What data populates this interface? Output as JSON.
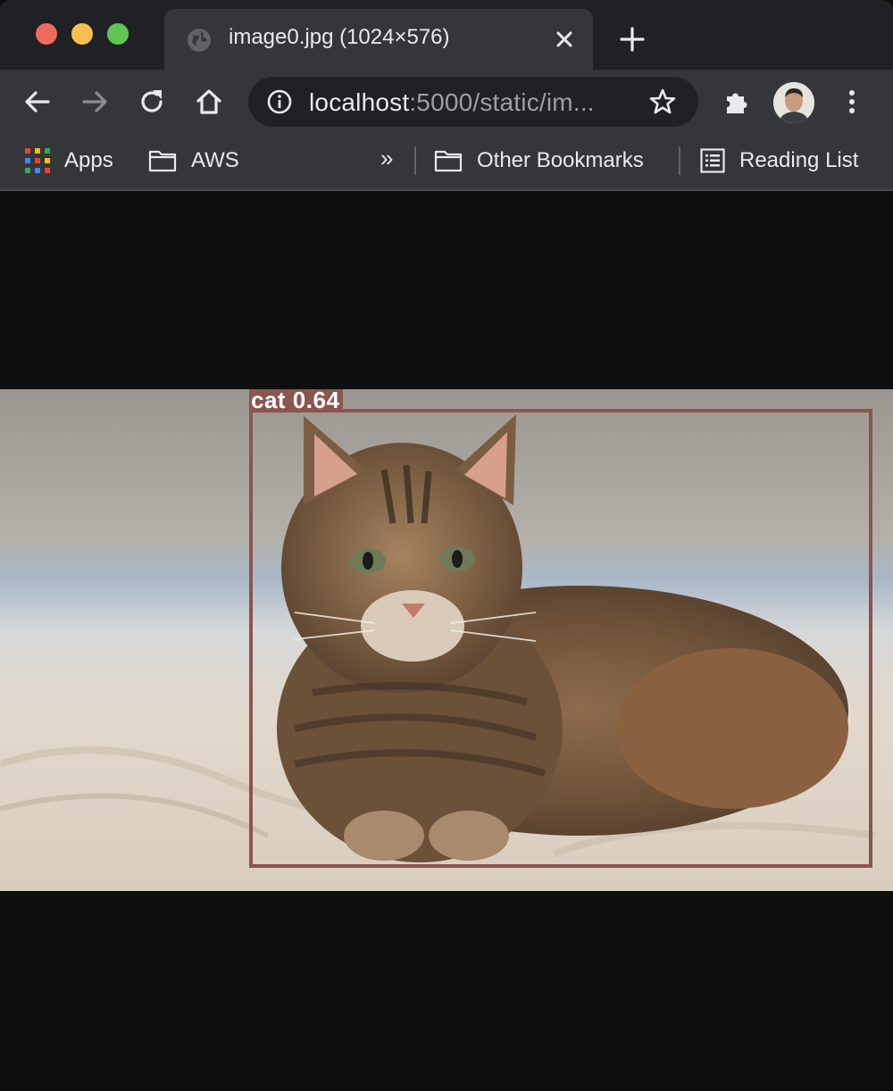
{
  "browser": {
    "tab": {
      "title": "image0.jpg (1024×576)"
    },
    "address": {
      "host": "localhost",
      "rest": ":5000/static/im..."
    },
    "bookmarks": {
      "apps": "Apps",
      "aws": "AWS",
      "overflow": "»",
      "other": "Other Bookmarks",
      "reading_list": "Reading List"
    }
  },
  "content": {
    "detection": {
      "label": "cat 0.64",
      "box_color": "#8b5550"
    }
  },
  "icons": {
    "back": "arrow-left-icon",
    "forward": "arrow-right-icon",
    "reload": "reload-icon",
    "home": "home-icon",
    "info": "info-icon",
    "star": "star-icon",
    "extensions": "puzzle-icon",
    "menu": "kebab-menu-icon"
  }
}
